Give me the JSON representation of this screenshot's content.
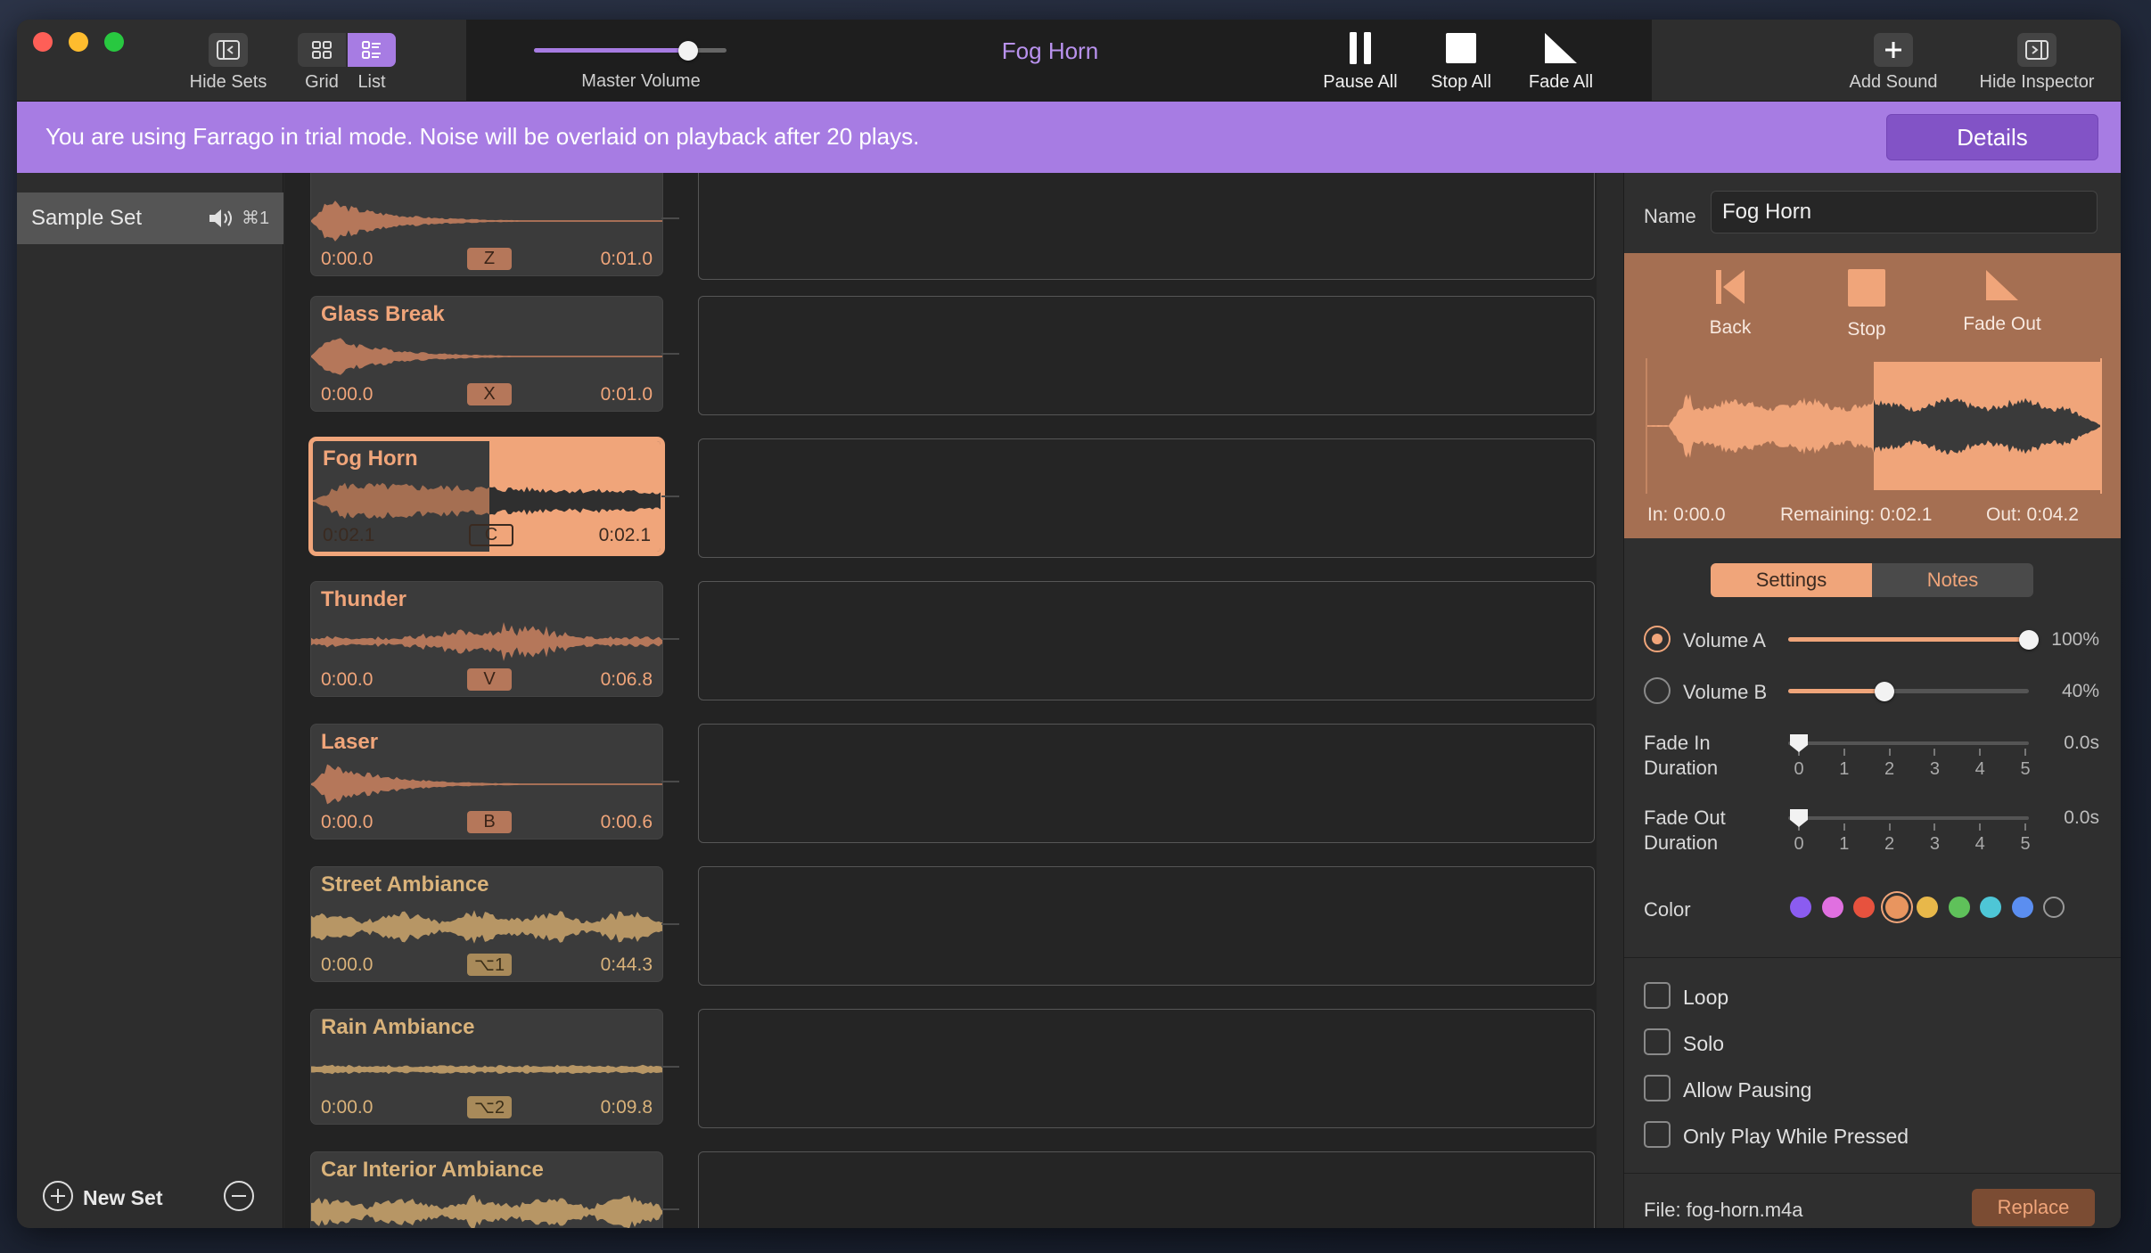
{
  "toolbar": {
    "hide_sets": "Hide Sets",
    "grid": "Grid",
    "list": "List",
    "master_volume": "Master Volume",
    "master_volume_level": 0.8,
    "now_playing": "Fog Horn",
    "pause_all": "Pause All",
    "stop_all": "Stop All",
    "fade_all": "Fade All",
    "add_sound": "Add Sound",
    "hide_inspector": "Hide Inspector"
  },
  "banner": {
    "message": "You are using Farrago in trial mode. Noise will be overlaid on playback after 20 plays.",
    "details": "Details"
  },
  "sidebar": {
    "set_name": "Sample Set",
    "set_shortcut": "⌘1",
    "new_set": "New Set"
  },
  "tiles": [
    {
      "name": "",
      "in": "0:00.0",
      "key": "Z",
      "out": "0:01.0",
      "color": "orange"
    },
    {
      "name": "Glass Break",
      "in": "0:00.0",
      "key": "X",
      "out": "0:01.0",
      "color": "orange"
    },
    {
      "name": "Fog Horn",
      "in": "0:02.1",
      "key": "C",
      "out": "0:02.1",
      "color": "active"
    },
    {
      "name": "Thunder",
      "in": "0:00.0",
      "key": "V",
      "out": "0:06.8",
      "color": "orange"
    },
    {
      "name": "Laser",
      "in": "0:00.0",
      "key": "B",
      "out": "0:00.6",
      "color": "orange"
    },
    {
      "name": "Street Ambiance",
      "in": "0:00.0",
      "key": "⌥1",
      "out": "0:44.3",
      "color": "tan"
    },
    {
      "name": "Rain Ambiance",
      "in": "0:00.0",
      "key": "⌥2",
      "out": "0:09.8",
      "color": "tan"
    },
    {
      "name": "Car Interior Ambiance",
      "in": "",
      "key": "",
      "out": "",
      "color": "tan"
    }
  ],
  "inspector": {
    "name_label": "Name",
    "name_value": "Fog Horn",
    "back": "Back",
    "stop": "Stop",
    "fade_out": "Fade Out",
    "in_time": "In: 0:00.0",
    "remaining": "Remaining: 0:02.1",
    "out_time": "Out: 0:04.2",
    "playback_progress": 0.5,
    "tab_settings": "Settings",
    "tab_notes": "Notes",
    "volume_a_label": "Volume A",
    "volume_a_value": "100%",
    "volume_a_level": 1.0,
    "volume_b_label": "Volume B",
    "volume_b_value": "40%",
    "volume_b_level": 0.4,
    "fade_in_label_1": "Fade In",
    "fade_in_label_2": "Duration",
    "fade_in_value": "0.0s",
    "fade_out_label_1": "Fade Out",
    "fade_out_label_2": "Duration",
    "fade_out_value": "0.0s",
    "ticks": [
      "0",
      "1",
      "2",
      "3",
      "4",
      "5"
    ],
    "color_label": "Color",
    "colors": [
      "#8b5cf0",
      "#e070e0",
      "#e7523e",
      "#e8955f",
      "#e8b84a",
      "#5fc15a",
      "#4ec6d6",
      "#5b8ef0",
      "none"
    ],
    "selected_color": "#e8955f",
    "loop": "Loop",
    "solo": "Solo",
    "allow_pausing": "Allow Pausing",
    "only_play_while_pressed": "Only Play While Pressed",
    "file": "File: fog-horn.m4a",
    "replace": "Replace"
  },
  "colors": {
    "accent": "#a77ce3",
    "tile_orange": "#f0a57a",
    "tile_tan": "#d9b27a",
    "active_tile": "#f0a57a"
  }
}
